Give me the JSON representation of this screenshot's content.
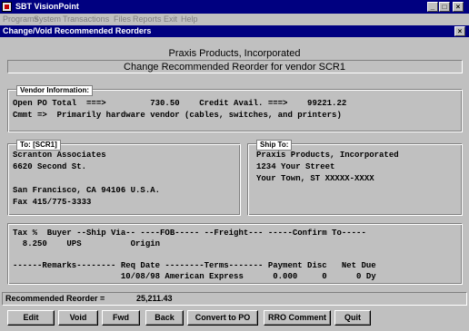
{
  "app": {
    "title": "SBT VisionPoint",
    "window_buttons": [
      "_",
      "□",
      "×"
    ]
  },
  "menu": [
    "Programs",
    "System",
    "Transactions",
    "Files",
    "Reports",
    "Exit",
    "Help"
  ],
  "child": {
    "title": "Change/Void Recommended Reorders",
    "close": "×"
  },
  "header": {
    "company": "Praxis Products, Incorporated",
    "subtitle": "Change Recommended Reorder for vendor SCR1"
  },
  "vendor": {
    "label": "Vendor Information:",
    "line1": "Open PO Total  ===>         730.50    Credit Avail. ===>    99221.22",
    "line2": "Cmmt =>  Primarily hardware vendor (cables, switches, and printers)"
  },
  "to": {
    "label": "To: [SCR1]",
    "lines": [
      "Scranton Associates",
      "6620 Second St.",
      "",
      "San Francisco, CA 94106 U.S.A.",
      "Fax 415/775-3333"
    ]
  },
  "shipto": {
    "label": "Ship To:",
    "lines": [
      "Praxis Products, Incorporated",
      "1234 Your Street",
      "Your Town, ST XXXXX-XXXX"
    ]
  },
  "order": {
    "header1": "Tax %  Buyer --Ship Via-- ----FOB----- --Freight--- -----Confirm To-----",
    "values1": "  8.250    UPS          Origin",
    "header2": "------Remarks-------- Req Date --------Terms------- Payment Disc   Net Due",
    "values2": "                      10/08/98 American Express      0.000     0      0 Dy"
  },
  "reorder": {
    "label": "Recommended Reorder =",
    "value": "25,211.43"
  },
  "buttons": {
    "edit": "Edit",
    "void": "Void",
    "fwd": "Fwd",
    "back": "Back",
    "convert": "Convert to PO",
    "rro": "RRO Comment",
    "quit": "Quit"
  },
  "colors": {
    "titlebar": "#000080",
    "face": "#c0c0c0"
  }
}
